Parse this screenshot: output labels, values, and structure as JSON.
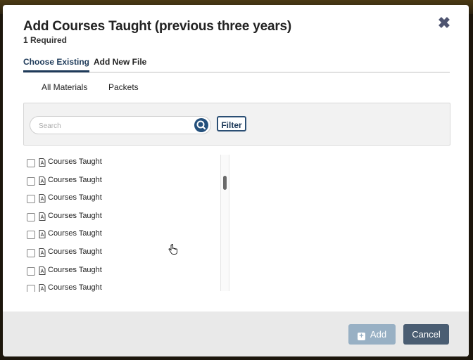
{
  "dialog": {
    "title": "Add Courses Taught (previous three years)",
    "subtitle": "1 Required",
    "close_icon": "close-icon"
  },
  "tabs": [
    {
      "label": "Choose Existing",
      "active": true
    },
    {
      "label": "Add New File",
      "active": false
    }
  ],
  "subtabs": [
    {
      "label": "All Materials"
    },
    {
      "label": "Packets"
    }
  ],
  "search": {
    "placeholder": "Search",
    "value": "",
    "button_icon": "search-icon",
    "filter_label": "Filter"
  },
  "list": {
    "items": [
      {
        "label": "Courses Taught",
        "icon": "pdf-file-icon",
        "checked": false
      },
      {
        "label": "Courses Taught",
        "icon": "pdf-file-icon",
        "checked": false
      },
      {
        "label": "Courses Taught",
        "icon": "pdf-file-icon",
        "checked": false
      },
      {
        "label": "Courses Taught",
        "icon": "pdf-file-icon",
        "checked": false
      },
      {
        "label": "Courses Taught",
        "icon": "pdf-file-icon",
        "checked": false
      },
      {
        "label": "Courses Taught",
        "icon": "pdf-file-icon",
        "checked": false
      },
      {
        "label": "Courses Taught",
        "icon": "pdf-file-icon",
        "checked": false
      },
      {
        "label": "Courses Taught",
        "icon": "pdf-file-icon",
        "checked": false
      }
    ]
  },
  "footer": {
    "add_label": "Add",
    "add_icon": "plus-square-icon",
    "cancel_label": "Cancel"
  },
  "colors": {
    "accent": "#1f3b5a",
    "add_button_disabled": "#98b0c4",
    "cancel_button": "#4a5d72"
  }
}
